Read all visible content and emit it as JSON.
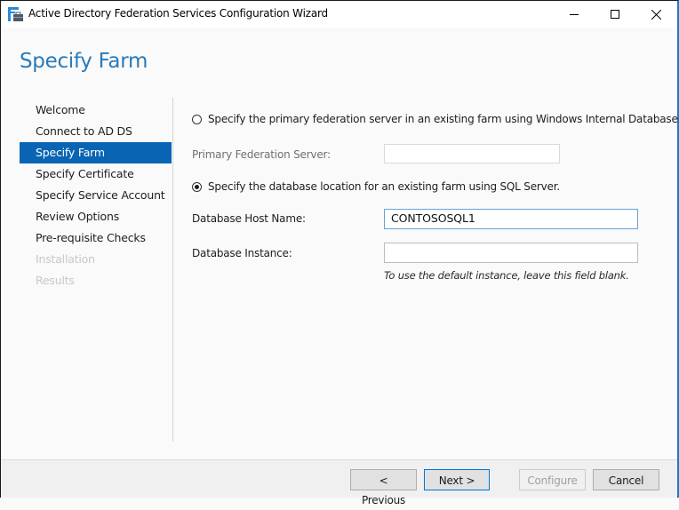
{
  "window": {
    "title": "Active Directory Federation Services Configuration Wizard",
    "app_icon": "adfs-wizard-icon",
    "controls": {
      "minimize": "minimize-icon",
      "maximize": "maximize-icon",
      "close": "close-icon"
    }
  },
  "page": {
    "title": "Specify Farm"
  },
  "sidebar": {
    "items": [
      {
        "label": "Welcome",
        "state": "normal"
      },
      {
        "label": "Connect to AD DS",
        "state": "normal"
      },
      {
        "label": "Specify Farm",
        "state": "active"
      },
      {
        "label": "Specify Certificate",
        "state": "normal"
      },
      {
        "label": "Specify Service Account",
        "state": "normal"
      },
      {
        "label": "Review Options",
        "state": "normal"
      },
      {
        "label": "Pre-requisite Checks",
        "state": "normal"
      },
      {
        "label": "Installation",
        "state": "disabled"
      },
      {
        "label": "Results",
        "state": "disabled"
      }
    ]
  },
  "form": {
    "option_wid": {
      "label": "Specify the primary federation server in an existing farm using Windows Internal Database.",
      "checked": false
    },
    "primary_server": {
      "label": "Primary Federation Server:",
      "value": "",
      "enabled": false
    },
    "option_sql": {
      "label": "Specify the database location for an existing farm using SQL Server.",
      "checked": true
    },
    "db_host": {
      "label": "Database Host Name:",
      "value": "CONTOSOSQL1"
    },
    "db_instance": {
      "label": "Database Instance:",
      "value": "",
      "hint": "To use the default instance, leave this field blank."
    }
  },
  "footer": {
    "previous_label": "< Previous",
    "next_label": "Next >",
    "configure_label": "Configure",
    "cancel_label": "Cancel"
  },
  "colors": {
    "accent": "#0a64b4",
    "title_blue": "#2a7ab8",
    "window_border": "#1979ca"
  }
}
